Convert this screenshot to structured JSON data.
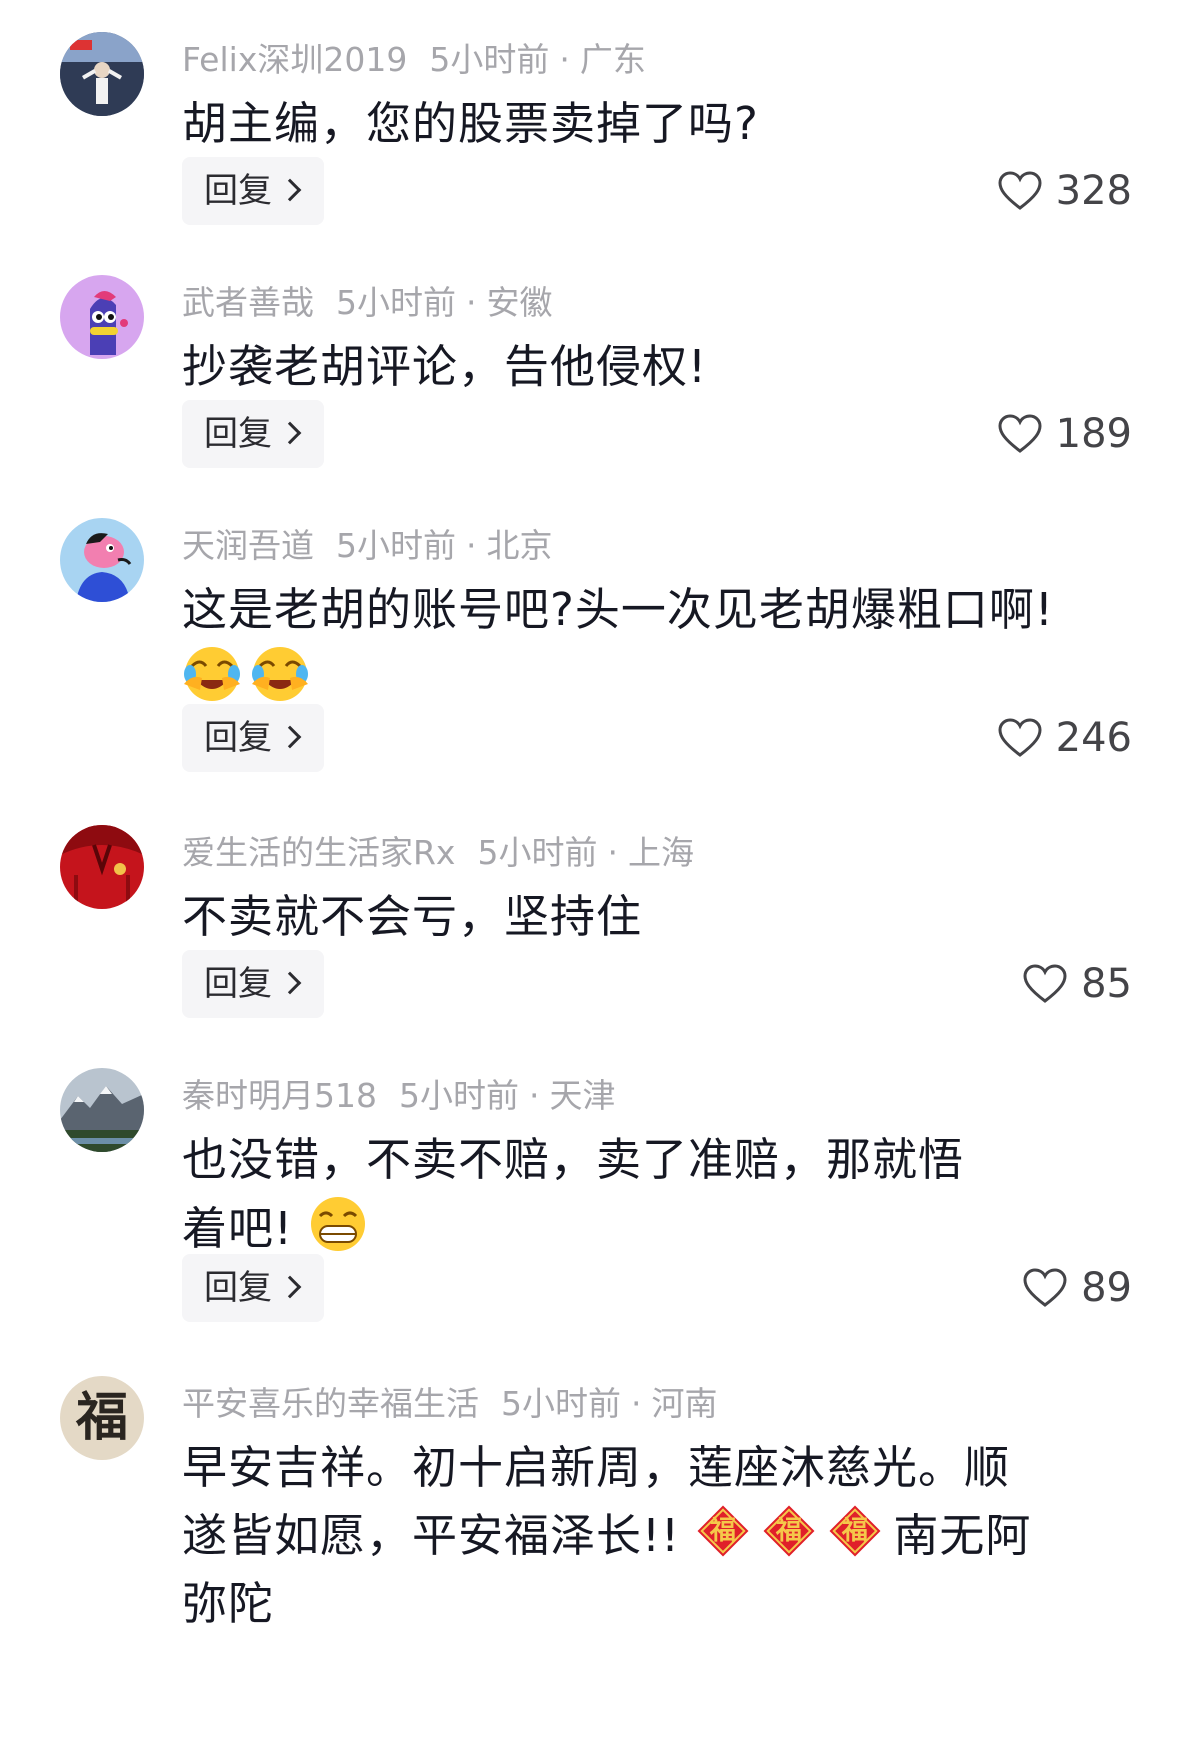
{
  "comments": [
    {
      "username": "Felix深圳2019",
      "time": "5小时前",
      "location": "广东",
      "text": "胡主编，您的股票卖掉了吗?",
      "reply_label": "回复",
      "likes": "328"
    },
    {
      "username": "武者善哉",
      "time": "5小时前",
      "location": "安徽",
      "text": "抄袭老胡评论，告他侵权!",
      "reply_label": "回复",
      "likes": "189"
    },
    {
      "username": "天润吾道",
      "time": "5小时前",
      "location": "北京",
      "text": "这是老胡的账号吧?头一次见老胡爆粗口啊!",
      "emojis": [
        "laugh-cry-emoji",
        "laugh-cry-emoji"
      ],
      "reply_label": "回复",
      "likes": "246"
    },
    {
      "username": "爱生活的生活家Rx",
      "time": "5小时前",
      "location": "上海",
      "text": "不卖就不会亏，坚持住",
      "reply_label": "回复",
      "likes": "85"
    },
    {
      "username": "秦时明月518",
      "time": "5小时前",
      "location": "天津",
      "text": "也没错，不卖不赔，卖了准赔，那就悟着吧!",
      "emojis": [
        "grin-emoji"
      ],
      "reply_label": "回复",
      "likes": "89"
    },
    {
      "username": "平安喜乐的幸福生活",
      "time": "5小时前",
      "location": "河南",
      "text_part1": "早安吉祥。初十启新周，莲座沐慈光。顺遂皆如愿，平安福泽长!!",
      "fu_char": "福",
      "text_part2": "南无阿弥陀",
      "avatar_char": "福"
    }
  ],
  "colors": {
    "meta": "#a6a6ab",
    "text": "#161823",
    "reply_bg": "#f5f5f7"
  }
}
